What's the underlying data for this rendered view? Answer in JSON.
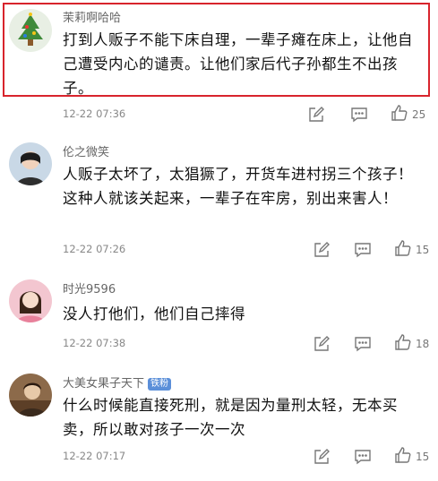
{
  "comments": [
    {
      "username": "茉莉啊哈哈",
      "text": "打到人贩子不能下床自理，一辈子瘫在床上，让他自己遭受内心的谴责。让他们家后代子孙都生不出孩子。",
      "time": "12-22 07:36",
      "likes": "25",
      "highlighted": true,
      "avatar_icon": "christmas-tree-avatar"
    },
    {
      "username": "伦之微笑",
      "text": "人贩子太坏了，太猖獗了，开货车进村拐三个孩子！这种人就该关起来，一辈子在牢房，别出来害人！",
      "time": "12-22 07:26",
      "likes": "15",
      "avatar_icon": "woman-portrait-avatar"
    },
    {
      "username": "时光9596",
      "text": "没人打他们，他们自己摔得",
      "time": "12-22 07:38",
      "likes": "18",
      "avatar_icon": "pink-portrait-avatar"
    },
    {
      "username": "大美女果子天下",
      "badge": "铁粉",
      "text": "什么时候能直接死刑，就是因为量刑太轻，无本买卖，所以敢对孩子一次一次",
      "time": "12-22 07:17",
      "likes": "15",
      "avatar_icon": "brown-portrait-avatar"
    }
  ],
  "colors": {
    "highlight_border": "#d8242c",
    "badge_bg": "#5b8fd9",
    "username": "#666666",
    "meta": "#888888"
  },
  "icons": {
    "edit": "pencil-square-icon",
    "comment": "speech-bubble-icon",
    "like": "thumbs-up-icon"
  }
}
